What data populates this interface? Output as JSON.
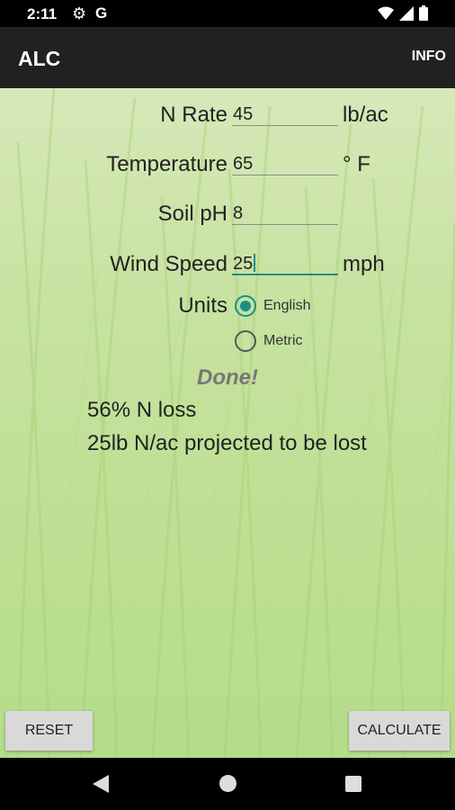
{
  "status_bar": {
    "time": "2:11",
    "g_label": "G"
  },
  "app_bar": {
    "title": "ALC",
    "info_label": "INFO"
  },
  "form": {
    "n_rate": {
      "label": "N Rate",
      "value": "45",
      "unit": "lb/ac"
    },
    "temperature": {
      "label": "Temperature",
      "value": "65",
      "unit": "° F"
    },
    "soil_ph": {
      "label": "Soil pH",
      "value": "8"
    },
    "wind_speed": {
      "label": "Wind Speed",
      "value": "25",
      "unit": "mph"
    },
    "units": {
      "label": "Units",
      "options": [
        "English",
        "Metric"
      ],
      "selected": "English"
    }
  },
  "status_text": "Done!",
  "results": {
    "loss_percent": "56% N loss",
    "loss_amount": "25lb N/ac projected to be lost"
  },
  "buttons": {
    "reset": "RESET",
    "calculate": "CALCULATE"
  },
  "colors": {
    "accent": "#1a8f8a",
    "app_bar": "#212121"
  }
}
